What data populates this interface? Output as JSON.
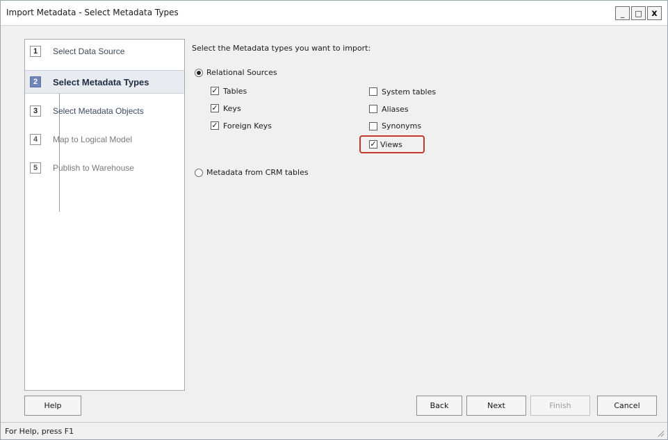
{
  "window": {
    "title": "Import Metadata - Select Metadata Types",
    "controls": {
      "minimize": "_",
      "maximize": "□",
      "close": "x"
    }
  },
  "steps": [
    {
      "num": "1",
      "label": "Select Data Source",
      "state": "done"
    },
    {
      "num": "2",
      "label": "Select Metadata Types",
      "state": "active"
    },
    {
      "num": "3",
      "label": "Select Metadata Objects",
      "state": "enabled"
    },
    {
      "num": "4",
      "label": "Map to Logical Model",
      "state": "disabled"
    },
    {
      "num": "5",
      "label": "Publish to Warehouse",
      "state": "disabled"
    }
  ],
  "content": {
    "prompt": "Select the Metadata types you want to import:",
    "radio_relational": {
      "label": "Relational Sources",
      "checked": true
    },
    "radio_crm": {
      "label": "Metadata from CRM tables",
      "checked": false
    },
    "checkboxes": {
      "tables": {
        "label": "Tables",
        "checked": true
      },
      "keys": {
        "label": "Keys",
        "checked": true
      },
      "foreign_keys": {
        "label": "Foreign Keys",
        "checked": true
      },
      "system_tables": {
        "label": "System tables",
        "checked": false
      },
      "aliases": {
        "label": "Aliases",
        "checked": false
      },
      "synonyms": {
        "label": "Synonyms",
        "checked": false
      },
      "views": {
        "label": "Views",
        "checked": true
      }
    },
    "highlight_color": "#c0392b"
  },
  "buttons": {
    "help": "Help",
    "back": "Back",
    "next": "Next",
    "finish": "Finish",
    "cancel": "Cancel"
  },
  "status": {
    "text": "For Help, press F1"
  },
  "colors": {
    "active_step": "#6f86b8",
    "window_bg": "#f0f0f0"
  }
}
